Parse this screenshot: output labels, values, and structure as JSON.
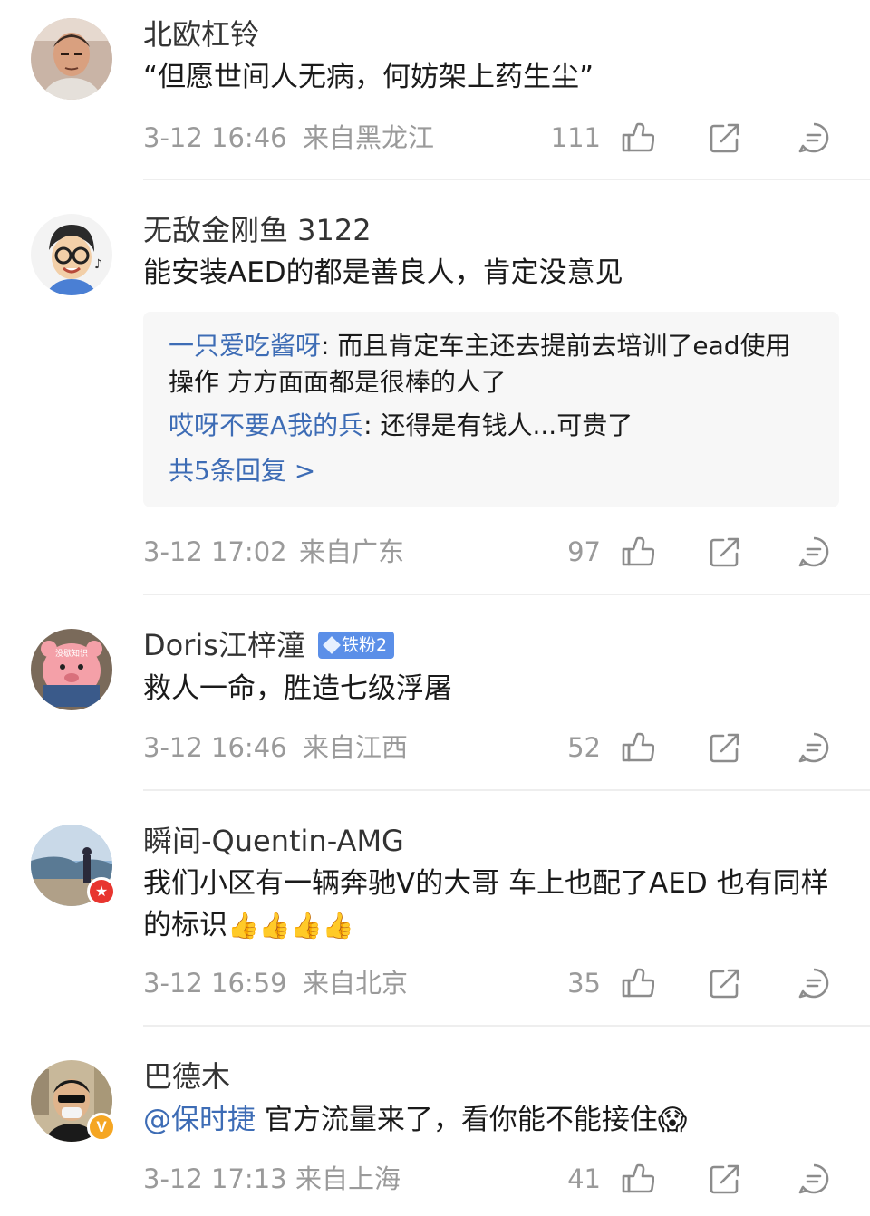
{
  "comments": [
    {
      "username": "北欧杠铃",
      "text": "“但愿世间人无病，何妨架上药生尘”",
      "time": "3-12 16:46",
      "location": "来自黑龙江",
      "likes": "111"
    },
    {
      "username": "无敌金刚鱼 3122",
      "text": "能安装AED的都是善良人，肯定没意见",
      "time": "3-12 17:02",
      "location": "来自广东",
      "likes": "97",
      "replies": [
        {
          "author": "一只爱吃酱呀",
          "text": ": 而且肯定车主还去提前去培训了ead使用操作 方方面面都是很棒的人了"
        },
        {
          "author": "哎呀不要A我的兵",
          "text": ": 还得是有钱人...可贵了"
        }
      ],
      "more_replies": "共5条回复 >"
    },
    {
      "username": "Doris江梓潼",
      "fan_badge": "铁粉2",
      "text": "救人一命，胜造七级浮屠",
      "time": "3-12 16:46",
      "location": "来自江西",
      "likes": "52"
    },
    {
      "username": "瞬间-Quentin-AMG",
      "text": "我们小区有一辆奔驰V的大哥  车上也配了AED  也有同样的标识",
      "emoji": "👍👍👍👍",
      "time": "3-12 16:59",
      "location": "来自北京",
      "likes": "35",
      "badge": "★"
    },
    {
      "username": "巴德木",
      "mention": "@保时捷",
      "text": " 官方流量来了，看你能不能接住",
      "emoji": "😱",
      "time": "3-12 17:13",
      "location": "来自上海",
      "likes": "41",
      "badge": "V"
    }
  ],
  "icons": {
    "like": "thumbs-up-icon",
    "share": "share-icon",
    "reply": "comment-icon"
  },
  "colors": {
    "link": "#3d6cb5",
    "meta": "#9a9a9a",
    "fan_badge": "#5b8fe8",
    "badge_star": "#e8352f",
    "badge_v": "#f5a623"
  }
}
